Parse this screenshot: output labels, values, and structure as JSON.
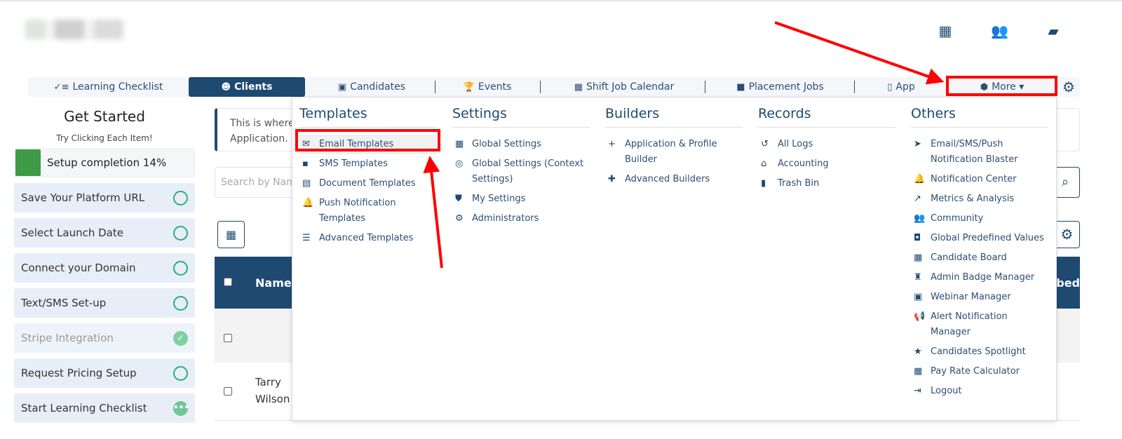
{
  "header": {
    "icons": [
      "calendar-icon",
      "users-icon",
      "chat-icon"
    ]
  },
  "nav": {
    "items": [
      {
        "label": "Learning Checklist",
        "icon": "checklist-icon"
      },
      {
        "label": "Clients",
        "icon": "clients-icon"
      },
      {
        "label": "Candidates",
        "icon": "badge-icon"
      },
      {
        "label": "Events",
        "icon": "trophy-icon"
      },
      {
        "label": "Shift Job Calendar",
        "icon": "calendar-icon"
      },
      {
        "label": "Placement Jobs",
        "icon": "briefcase-icon"
      },
      {
        "label": "App",
        "icon": "phone-icon"
      }
    ],
    "more": "More ▾"
  },
  "sidebar": {
    "title": "Get Started",
    "subtitle": "Try Clicking Each Item!",
    "progress_label": "Setup completion 14%",
    "progress": 14,
    "steps": [
      {
        "label": "Save Your Platform URL",
        "status": "todo"
      },
      {
        "label": "Select Launch Date",
        "status": "todo"
      },
      {
        "label": "Connect your Domain",
        "status": "todo"
      },
      {
        "label": "Text/SMS Set-up",
        "status": "todo"
      },
      {
        "label": "Stripe Integration",
        "status": "done"
      },
      {
        "label": "Request Pricing Setup",
        "status": "todo"
      },
      {
        "label": "Start Learning Checklist",
        "status": "in-progress"
      }
    ]
  },
  "main": {
    "info_line1": "This is where",
    "info_line2": "Application.",
    "search_placeholder": "Search by Nam",
    "table": {
      "header_name": "Name",
      "header_right": "ribed",
      "rows": [
        {
          "name": ""
        },
        {
          "name": "Tarry Wilson"
        }
      ]
    }
  },
  "dropdown": {
    "columns": [
      {
        "title": "Templates",
        "items": [
          "Email Templates",
          "SMS Templates",
          "Document Templates",
          "Push Notification Templates",
          "Advanced Templates"
        ],
        "icons": [
          "✉",
          "▪",
          "▤",
          "🔔",
          "☰"
        ]
      },
      {
        "title": "Settings",
        "items": [
          "Global Settings",
          "Global Settings (Context Settings)",
          "My Settings",
          "Administrators"
        ],
        "icons": [
          "▦",
          "◎",
          "⛊",
          "⚙"
        ]
      },
      {
        "title": "Builders",
        "items": [
          "Application & Profile Builder",
          "Advanced Builders"
        ],
        "icons": [
          "+",
          "✚"
        ]
      },
      {
        "title": "Records",
        "items": [
          "All Logs",
          "Accounting",
          "Trash Bin"
        ],
        "icons": [
          "↺",
          "⌂",
          "▮"
        ]
      },
      {
        "title": "Others",
        "items": [
          "Email/SMS/Push Notification Blaster",
          "Notification Center",
          "Metrics & Analysis",
          "Community",
          "Global Predefined Values",
          "Candidate Board",
          "Admin Badge Manager",
          "Webinar Manager",
          "Alert Notification Manager",
          "Candidates Spotlight",
          "Pay Rate Calculator",
          "Logout"
        ],
        "icons": [
          "➤",
          "🔔",
          "↗",
          "👥",
          "◘",
          "▦",
          "♜",
          "▣",
          "📢",
          "★",
          "▦",
          "⇥"
        ]
      }
    ]
  },
  "annotation_color": "#ff0000",
  "accent": "#1e4a72"
}
